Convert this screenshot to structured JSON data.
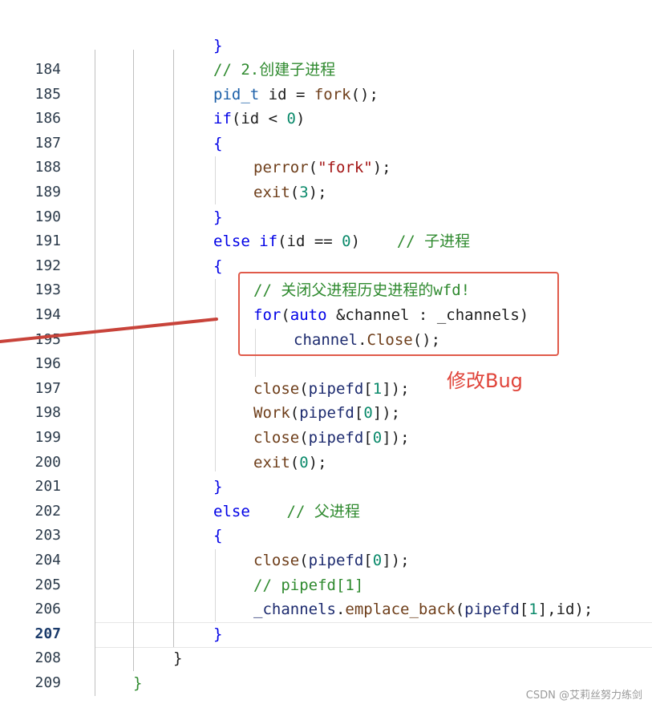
{
  "editor": {
    "lines": [
      {
        "num": "184",
        "tokens": [
          {
            "t": "// 2.创建子进程",
            "c": "cm"
          }
        ]
      },
      {
        "num": "185",
        "tokens": [
          {
            "t": "pid_t",
            "c": "type"
          },
          {
            "t": " id = ",
            "c": "punc"
          },
          {
            "t": "fork",
            "c": "fn"
          },
          {
            "t": "();",
            "c": "punc"
          }
        ]
      },
      {
        "num": "186",
        "tokens": [
          {
            "t": "if",
            "c": "kw"
          },
          {
            "t": "(id < ",
            "c": "punc"
          },
          {
            "t": "0",
            "c": "num"
          },
          {
            "t": ")",
            "c": "punc"
          }
        ]
      },
      {
        "num": "187",
        "tokens": [
          {
            "t": "{",
            "c": "kw"
          }
        ]
      },
      {
        "num": "188",
        "tokens": [
          {
            "t": "perror",
            "c": "fn"
          },
          {
            "t": "(",
            "c": "punc"
          },
          {
            "t": "\"fork\"",
            "c": "str"
          },
          {
            "t": ");",
            "c": "punc"
          }
        ]
      },
      {
        "num": "189",
        "tokens": [
          {
            "t": "exit",
            "c": "fn"
          },
          {
            "t": "(",
            "c": "punc"
          },
          {
            "t": "3",
            "c": "num"
          },
          {
            "t": ");",
            "c": "punc"
          }
        ]
      },
      {
        "num": "190",
        "tokens": [
          {
            "t": "}",
            "c": "kw"
          }
        ]
      },
      {
        "num": "191",
        "tokens": [
          {
            "t": "else if",
            "c": "kw"
          },
          {
            "t": "(id == ",
            "c": "punc"
          },
          {
            "t": "0",
            "c": "num"
          },
          {
            "t": ")    ",
            "c": "punc"
          },
          {
            "t": "// 子进程",
            "c": "cm"
          }
        ]
      },
      {
        "num": "192",
        "tokens": [
          {
            "t": "{",
            "c": "kw"
          }
        ]
      },
      {
        "num": "193",
        "tokens": [
          {
            "t": "// 关闭父进程历史进程的wfd!",
            "c": "cm"
          }
        ]
      },
      {
        "num": "194",
        "tokens": [
          {
            "t": "for",
            "c": "kw"
          },
          {
            "t": "(",
            "c": "punc"
          },
          {
            "t": "auto",
            "c": "kw"
          },
          {
            "t": " &channel : _channels)",
            "c": "punc"
          }
        ]
      },
      {
        "num": "195",
        "tokens": [
          {
            "t": "channel",
            "c": "var"
          },
          {
            "t": ".",
            "c": "punc"
          },
          {
            "t": "Close",
            "c": "fn"
          },
          {
            "t": "();",
            "c": "punc"
          }
        ]
      },
      {
        "num": "196",
        "tokens": []
      },
      {
        "num": "197",
        "tokens": [
          {
            "t": "close",
            "c": "fn"
          },
          {
            "t": "(",
            "c": "punc"
          },
          {
            "t": "pipefd",
            "c": "var"
          },
          {
            "t": "[",
            "c": "punc"
          },
          {
            "t": "1",
            "c": "num"
          },
          {
            "t": "]);",
            "c": "punc"
          }
        ]
      },
      {
        "num": "198",
        "tokens": [
          {
            "t": "Work",
            "c": "fn"
          },
          {
            "t": "(",
            "c": "punc"
          },
          {
            "t": "pipefd",
            "c": "var"
          },
          {
            "t": "[",
            "c": "punc"
          },
          {
            "t": "0",
            "c": "num"
          },
          {
            "t": "]);",
            "c": "punc"
          }
        ]
      },
      {
        "num": "199",
        "tokens": [
          {
            "t": "close",
            "c": "fn"
          },
          {
            "t": "(",
            "c": "punc"
          },
          {
            "t": "pipefd",
            "c": "var"
          },
          {
            "t": "[",
            "c": "punc"
          },
          {
            "t": "0",
            "c": "num"
          },
          {
            "t": "]);",
            "c": "punc"
          }
        ]
      },
      {
        "num": "200",
        "tokens": [
          {
            "t": "exit",
            "c": "fn"
          },
          {
            "t": "(",
            "c": "punc"
          },
          {
            "t": "0",
            "c": "num"
          },
          {
            "t": ");",
            "c": "punc"
          }
        ]
      },
      {
        "num": "201",
        "tokens": [
          {
            "t": "}",
            "c": "kw"
          }
        ]
      },
      {
        "num": "202",
        "tokens": [
          {
            "t": "else",
            "c": "kw"
          },
          {
            "t": "    ",
            "c": "punc"
          },
          {
            "t": "// 父进程",
            "c": "cm"
          }
        ]
      },
      {
        "num": "203",
        "tokens": [
          {
            "t": "{",
            "c": "kw"
          }
        ]
      },
      {
        "num": "204",
        "tokens": [
          {
            "t": "close",
            "c": "fn"
          },
          {
            "t": "(",
            "c": "punc"
          },
          {
            "t": "pipefd",
            "c": "var"
          },
          {
            "t": "[",
            "c": "punc"
          },
          {
            "t": "0",
            "c": "num"
          },
          {
            "t": "]);",
            "c": "punc"
          }
        ]
      },
      {
        "num": "205",
        "tokens": [
          {
            "t": "// pipefd[1]",
            "c": "cm"
          }
        ]
      },
      {
        "num": "206",
        "tokens": [
          {
            "t": "_channels",
            "c": "var"
          },
          {
            "t": ".",
            "c": "punc"
          },
          {
            "t": "emplace_back",
            "c": "fn"
          },
          {
            "t": "(",
            "c": "punc"
          },
          {
            "t": "pipefd",
            "c": "var"
          },
          {
            "t": "[",
            "c": "punc"
          },
          {
            "t": "1",
            "c": "num"
          },
          {
            "t": "],id);",
            "c": "punc"
          }
        ]
      },
      {
        "num": "207",
        "tokens": [
          {
            "t": "}",
            "c": "kw"
          }
        ],
        "active": true
      },
      {
        "num": "208",
        "tokens": [
          {
            "t": "}",
            "c": "tok-punc"
          }
        ]
      },
      {
        "num": "209",
        "tokens": [
          {
            "t": "}",
            "c": "cm"
          }
        ]
      }
    ],
    "top_partial": "}"
  },
  "annotation": {
    "label": "修改Bug",
    "color": "#e0443a"
  },
  "watermark": "CSDN @艾莉丝努力练剑",
  "colors": {
    "keyword": "#0000e6",
    "comment": "#2f8a2f",
    "function": "#6e3e1a",
    "number": "#0b8a6b",
    "string": "#a31515",
    "annotation": "#e05a4a"
  }
}
